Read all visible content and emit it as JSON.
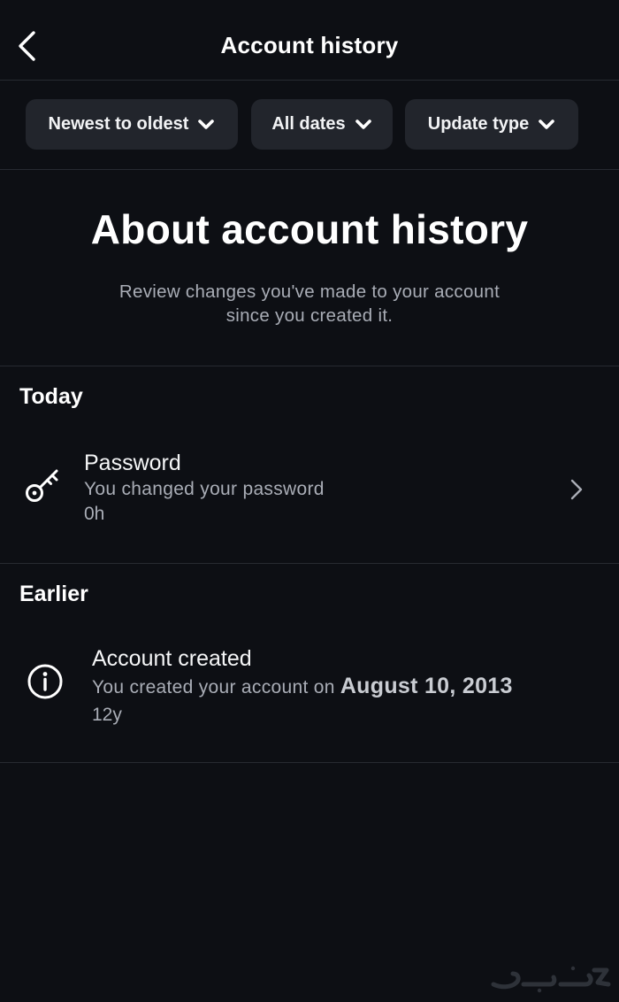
{
  "header": {
    "title": "Account history",
    "back_icon": "back-arrow-icon"
  },
  "filters": [
    {
      "label": "Newest to oldest",
      "icon": "chevron-down-icon"
    },
    {
      "label": "All dates",
      "icon": "chevron-down-icon"
    },
    {
      "label": "Update type",
      "icon": "chevron-down-icon"
    }
  ],
  "about": {
    "title": "About account history",
    "line1": "Review changes you've made to your account",
    "line2": "since you created it."
  },
  "sections": {
    "today": {
      "heading": "Today",
      "entry": {
        "icon": "key-icon",
        "title": "Password",
        "subtitle": "You changed your password",
        "age": "0h"
      }
    },
    "earlier": {
      "heading": "Earlier",
      "entry": {
        "icon": "info-icon",
        "title": "Account created",
        "subtitle_prefix": "You created your account on",
        "subtitle_date": "August 10, 2013",
        "age": "12y"
      }
    }
  },
  "colors": {
    "background": "#0d0f14",
    "chip": "#22252c",
    "divider": "#272a31",
    "secondary_text": "#a9adb6"
  }
}
